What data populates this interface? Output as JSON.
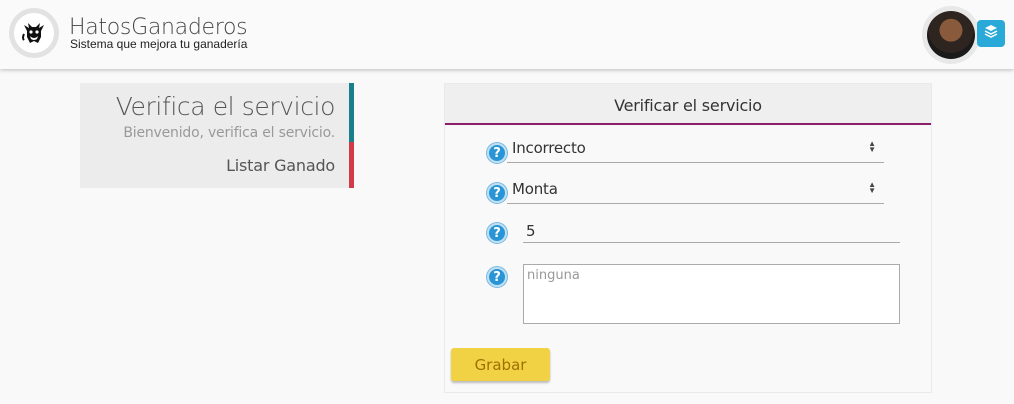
{
  "header": {
    "app_title": "HatosGanaderos",
    "app_subtitle": "Sistema que mejora tu ganadería",
    "logo_icon": "cow-icon",
    "layers_icon": "layers-icon"
  },
  "sidebar": {
    "title": "Verifica el servicio",
    "subtitle": "Bienvenido, verifica el servicio.",
    "items": [
      {
        "label": "Listar Ganado"
      }
    ],
    "accent_top": "#1a7f8c",
    "accent_item": "#d23a4a"
  },
  "panel": {
    "title": "Verificar el servicio",
    "accent": "#8b1f6a",
    "fields": {
      "resultado": {
        "value": "Incorrecto"
      },
      "tipo": {
        "value": "Monta"
      },
      "numero": {
        "value": "5"
      },
      "observacion": {
        "placeholder": "ninguna"
      }
    },
    "help_glyph": "?",
    "submit_label": "Grabar"
  },
  "colors": {
    "button": "#f2d245",
    "help": "#2a95d6",
    "layers_button": "#29a9d8"
  }
}
